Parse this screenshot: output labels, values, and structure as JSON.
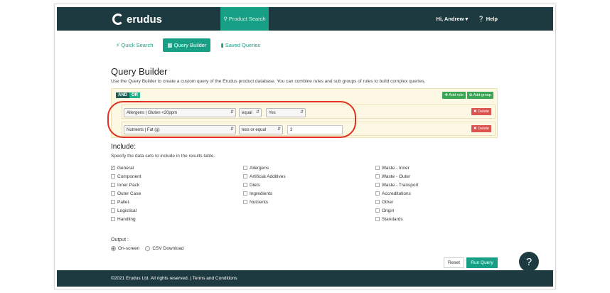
{
  "nav": {
    "brand": "erudus",
    "active_tab": "Product Search",
    "user": "Hi, Andrew",
    "help": "Help"
  },
  "tabs": [
    "Quick Search",
    "Query Builder",
    "Saved Queries"
  ],
  "page": {
    "title": "Query Builder",
    "description": "Use the Query Builder to create a custom query of the Erudus product database. You can combine rules and sub groups of rules to build complex queries."
  },
  "query": {
    "and": "AND",
    "or": "OR",
    "add_rule": "Add rule",
    "add_group": "Add group",
    "delete": "Delete",
    "rules": [
      {
        "field": "Allergens | Gluten <20ppm",
        "operator": "equal",
        "value": "Yes"
      },
      {
        "field": "Nutrients | Fat (g)",
        "operator": "less or equal",
        "value": "3"
      }
    ]
  },
  "include": {
    "title": "Include:",
    "description": "Specify the data sets to include in the results table.",
    "col1": [
      "General",
      "Component",
      "Inner Pack",
      "Outer Case",
      "Pallet",
      "Logistical",
      "Handling"
    ],
    "col2": [
      "Allergens",
      "Artificial Additives",
      "Diets",
      "Ingredients",
      "Nutrients"
    ],
    "col3": [
      "Waste - Inner",
      "Waste - Outer",
      "Waste - Transport",
      "Accreditations",
      "Other",
      "Origin",
      "Standards"
    ]
  },
  "output": {
    "label": "Output :",
    "onscreen": "On-screen",
    "csv": "CSV Download"
  },
  "buttons": {
    "reset": "Reset",
    "run": "Run Query"
  },
  "help_fab": "?",
  "footer": "©2021 Erudus Ltd. All rights reserved. | Terms and Conditions",
  "colors": {
    "navbar": "#1c3a3f",
    "accent": "#17a085",
    "delete": "#d9534f",
    "highlight": "#e0301e"
  }
}
